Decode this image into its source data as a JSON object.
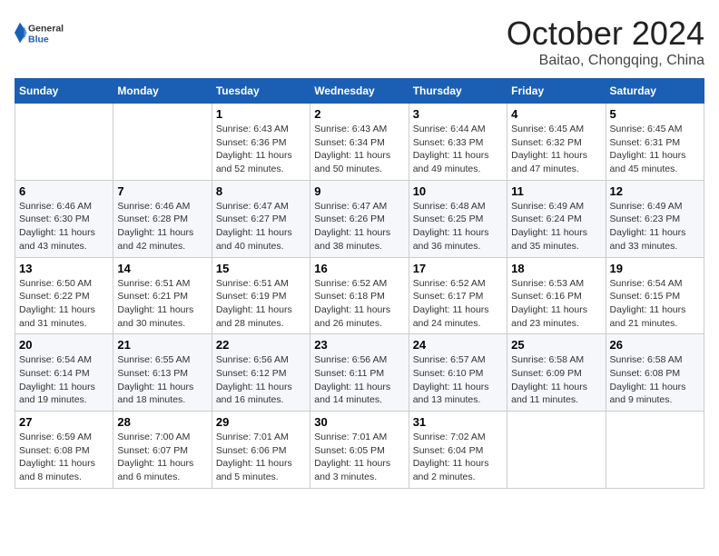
{
  "header": {
    "logo_general": "General",
    "logo_blue": "Blue",
    "month": "October 2024",
    "location": "Baitao, Chongqing, China"
  },
  "days_of_week": [
    "Sunday",
    "Monday",
    "Tuesday",
    "Wednesday",
    "Thursday",
    "Friday",
    "Saturday"
  ],
  "weeks": [
    [
      {
        "day": "",
        "info": ""
      },
      {
        "day": "",
        "info": ""
      },
      {
        "day": "1",
        "info": "Sunrise: 6:43 AM\nSunset: 6:36 PM\nDaylight: 11 hours and 52 minutes."
      },
      {
        "day": "2",
        "info": "Sunrise: 6:43 AM\nSunset: 6:34 PM\nDaylight: 11 hours and 50 minutes."
      },
      {
        "day": "3",
        "info": "Sunrise: 6:44 AM\nSunset: 6:33 PM\nDaylight: 11 hours and 49 minutes."
      },
      {
        "day": "4",
        "info": "Sunrise: 6:45 AM\nSunset: 6:32 PM\nDaylight: 11 hours and 47 minutes."
      },
      {
        "day": "5",
        "info": "Sunrise: 6:45 AM\nSunset: 6:31 PM\nDaylight: 11 hours and 45 minutes."
      }
    ],
    [
      {
        "day": "6",
        "info": "Sunrise: 6:46 AM\nSunset: 6:30 PM\nDaylight: 11 hours and 43 minutes."
      },
      {
        "day": "7",
        "info": "Sunrise: 6:46 AM\nSunset: 6:28 PM\nDaylight: 11 hours and 42 minutes."
      },
      {
        "day": "8",
        "info": "Sunrise: 6:47 AM\nSunset: 6:27 PM\nDaylight: 11 hours and 40 minutes."
      },
      {
        "day": "9",
        "info": "Sunrise: 6:47 AM\nSunset: 6:26 PM\nDaylight: 11 hours and 38 minutes."
      },
      {
        "day": "10",
        "info": "Sunrise: 6:48 AM\nSunset: 6:25 PM\nDaylight: 11 hours and 36 minutes."
      },
      {
        "day": "11",
        "info": "Sunrise: 6:49 AM\nSunset: 6:24 PM\nDaylight: 11 hours and 35 minutes."
      },
      {
        "day": "12",
        "info": "Sunrise: 6:49 AM\nSunset: 6:23 PM\nDaylight: 11 hours and 33 minutes."
      }
    ],
    [
      {
        "day": "13",
        "info": "Sunrise: 6:50 AM\nSunset: 6:22 PM\nDaylight: 11 hours and 31 minutes."
      },
      {
        "day": "14",
        "info": "Sunrise: 6:51 AM\nSunset: 6:21 PM\nDaylight: 11 hours and 30 minutes."
      },
      {
        "day": "15",
        "info": "Sunrise: 6:51 AM\nSunset: 6:19 PM\nDaylight: 11 hours and 28 minutes."
      },
      {
        "day": "16",
        "info": "Sunrise: 6:52 AM\nSunset: 6:18 PM\nDaylight: 11 hours and 26 minutes."
      },
      {
        "day": "17",
        "info": "Sunrise: 6:52 AM\nSunset: 6:17 PM\nDaylight: 11 hours and 24 minutes."
      },
      {
        "day": "18",
        "info": "Sunrise: 6:53 AM\nSunset: 6:16 PM\nDaylight: 11 hours and 23 minutes."
      },
      {
        "day": "19",
        "info": "Sunrise: 6:54 AM\nSunset: 6:15 PM\nDaylight: 11 hours and 21 minutes."
      }
    ],
    [
      {
        "day": "20",
        "info": "Sunrise: 6:54 AM\nSunset: 6:14 PM\nDaylight: 11 hours and 19 minutes."
      },
      {
        "day": "21",
        "info": "Sunrise: 6:55 AM\nSunset: 6:13 PM\nDaylight: 11 hours and 18 minutes."
      },
      {
        "day": "22",
        "info": "Sunrise: 6:56 AM\nSunset: 6:12 PM\nDaylight: 11 hours and 16 minutes."
      },
      {
        "day": "23",
        "info": "Sunrise: 6:56 AM\nSunset: 6:11 PM\nDaylight: 11 hours and 14 minutes."
      },
      {
        "day": "24",
        "info": "Sunrise: 6:57 AM\nSunset: 6:10 PM\nDaylight: 11 hours and 13 minutes."
      },
      {
        "day": "25",
        "info": "Sunrise: 6:58 AM\nSunset: 6:09 PM\nDaylight: 11 hours and 11 minutes."
      },
      {
        "day": "26",
        "info": "Sunrise: 6:58 AM\nSunset: 6:08 PM\nDaylight: 11 hours and 9 minutes."
      }
    ],
    [
      {
        "day": "27",
        "info": "Sunrise: 6:59 AM\nSunset: 6:08 PM\nDaylight: 11 hours and 8 minutes."
      },
      {
        "day": "28",
        "info": "Sunrise: 7:00 AM\nSunset: 6:07 PM\nDaylight: 11 hours and 6 minutes."
      },
      {
        "day": "29",
        "info": "Sunrise: 7:01 AM\nSunset: 6:06 PM\nDaylight: 11 hours and 5 minutes."
      },
      {
        "day": "30",
        "info": "Sunrise: 7:01 AM\nSunset: 6:05 PM\nDaylight: 11 hours and 3 minutes."
      },
      {
        "day": "31",
        "info": "Sunrise: 7:02 AM\nSunset: 6:04 PM\nDaylight: 11 hours and 2 minutes."
      },
      {
        "day": "",
        "info": ""
      },
      {
        "day": "",
        "info": ""
      }
    ]
  ]
}
